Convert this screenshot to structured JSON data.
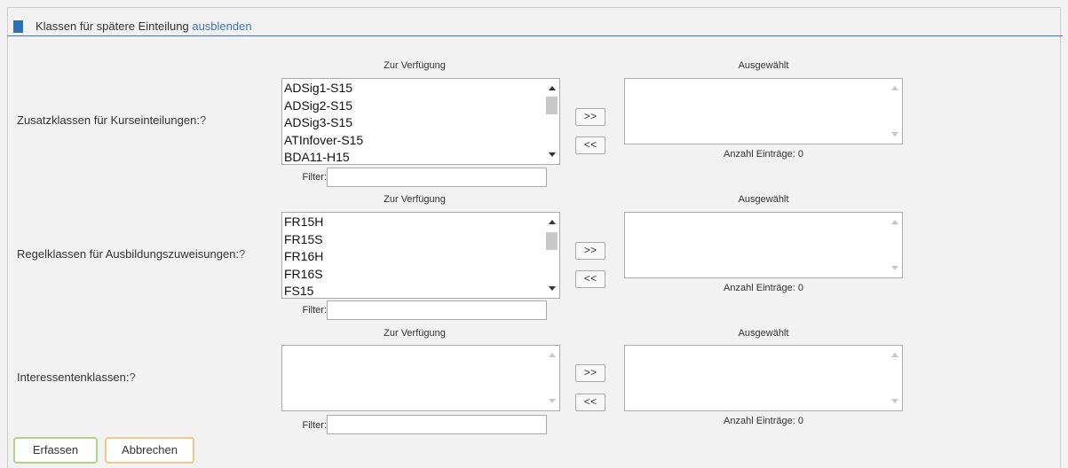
{
  "section": {
    "title": "Klassen für spätere Einteilung",
    "toggle_link": "ausblenden"
  },
  "columns": {
    "available_header": "Zur Verfügung",
    "selected_header": "Ausgewählt"
  },
  "rows": [
    {
      "label": "Zusatzklassen für Kurseinteilungen:",
      "help": "?",
      "available_items": [
        "ADSig1-S15",
        "ADSig2-S15",
        "ADSig3-S15",
        "ATInfover-S15",
        "BDA11-H15"
      ],
      "selected_items": [],
      "add_button": ">>",
      "remove_button": "<<",
      "count_text": "Anzahl Einträge: 0",
      "filter_label": "Filter:",
      "filter_value": ""
    },
    {
      "label": "Regelklassen für Ausbildungszuweisungen:",
      "help": "?",
      "available_items": [
        "FR15H",
        "FR15S",
        "FR16H",
        "FR16S",
        "FS15"
      ],
      "selected_items": [],
      "add_button": ">>",
      "remove_button": "<<",
      "count_text": "Anzahl Einträge: 0",
      "filter_label": "Filter:",
      "filter_value": ""
    },
    {
      "label": "Interessentenklassen:",
      "help": "?",
      "available_items": [],
      "selected_items": [],
      "add_button": ">>",
      "remove_button": "<<",
      "count_text": "Anzahl Einträge: 0",
      "filter_label": "Filter:",
      "filter_value": ""
    }
  ],
  "actions": {
    "submit_label": "Erfassen",
    "cancel_label": "Abbrechen"
  },
  "colors": {
    "accent": "#2f6fb5",
    "link": "#3a76b8",
    "submit_border": "#b5d28a",
    "cancel_border": "#f5c590"
  }
}
